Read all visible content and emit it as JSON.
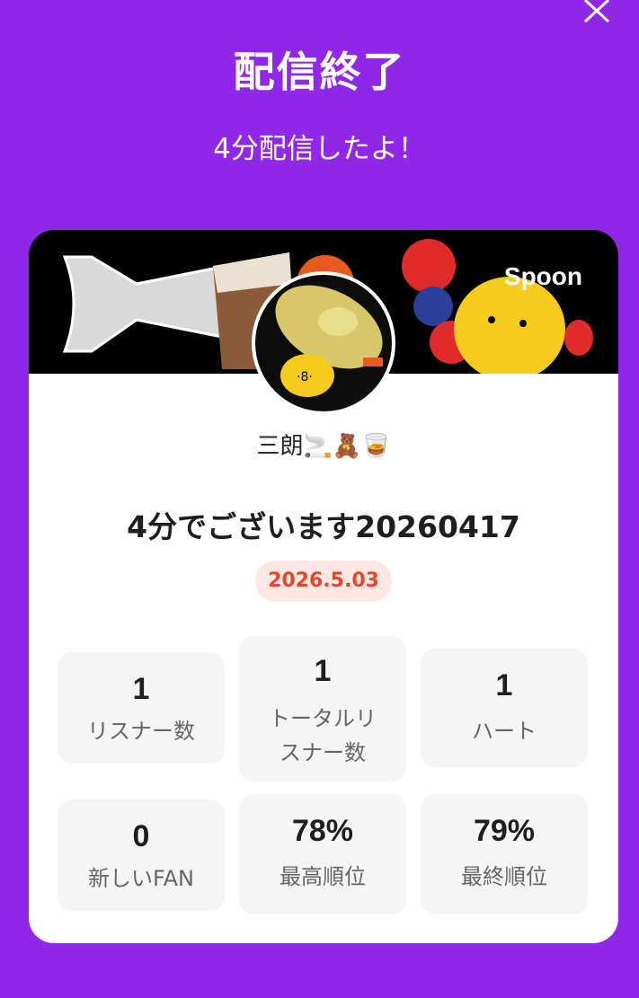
{
  "header": {
    "close_icon": "close-icon",
    "title": "配信終了",
    "subtitle": "4分配信したよ！"
  },
  "card": {
    "brand": "Spoon",
    "username": "三朗🚬🧸🥃",
    "broadcast_title": "4分でございます20260417",
    "date": "2026.5.03",
    "stats": [
      {
        "value": "1",
        "label": "リスナー数"
      },
      {
        "value": "1",
        "label": "トータルリスナー数"
      },
      {
        "value": "1",
        "label": "ハート"
      },
      {
        "value": "0",
        "label": "新しいFAN"
      },
      {
        "value": "78%",
        "label": "最高順位"
      },
      {
        "value": "79%",
        "label": "最終順位"
      }
    ]
  },
  "colors": {
    "background": "#9127e8",
    "card": "#ffffff",
    "badge_bg": "#fde7e2",
    "badge_text": "#e6462c",
    "stat_bg": "#f5f5f5"
  }
}
